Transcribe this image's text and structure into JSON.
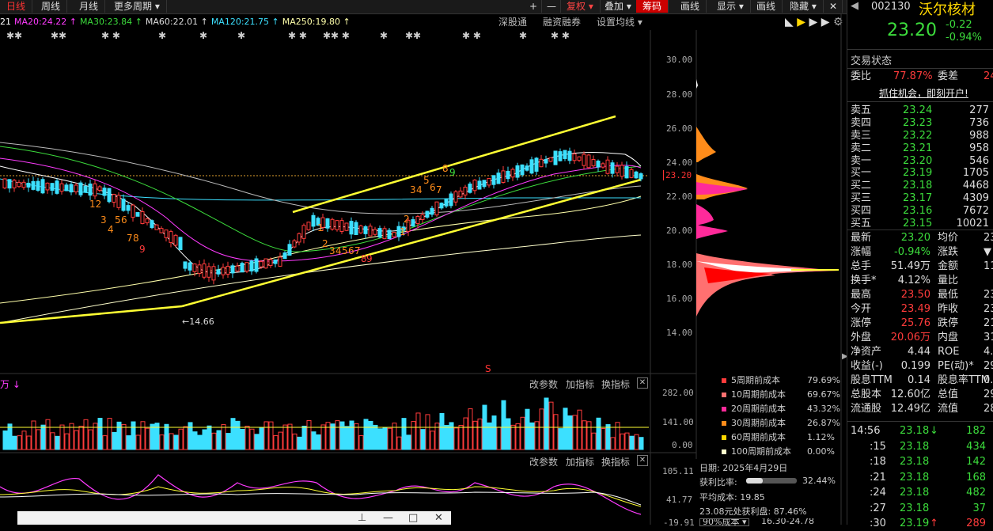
{
  "toolbar": {
    "items": [
      "日线",
      "周线",
      "月线",
      "更多周期"
    ],
    "right": [
      "+",
      "—",
      "复权",
      "叠加",
      "筹码",
      "画线",
      "显示",
      "画线",
      "隐藏"
    ]
  },
  "ma": [
    {
      "label": "21",
      "color": "#ffffff"
    },
    {
      "label": "MA20:24.22",
      "color": "#ff3bff"
    },
    {
      "label": "MA30:23.84",
      "color": "#3cdc3c"
    },
    {
      "label": "MA60:22.01",
      "color": "#dddddd"
    },
    {
      "label": "MA120:21.75",
      "color": "#3ce0ff"
    },
    {
      "label": "MA250:19.80",
      "color": "#ffffaa"
    }
  ],
  "links": {
    "a": "深股通",
    "b": "融资融券",
    "c": "设置均线"
  },
  "price_axis": [
    "30.00",
    "28.00",
    "26.00",
    "24.00",
    "23.20",
    "22.00",
    "20.00",
    "18.00",
    "16.00",
    "14.00"
  ],
  "low_mark": "←14.66",
  "vol_panel": {
    "unit": "万",
    "params": "改参数",
    "add": "加指标",
    "change": "换指标",
    "ticks": [
      "282.00",
      "141.00",
      "0.00"
    ]
  },
  "macd_panel": {
    "params": "改参数",
    "add": "加指标",
    "change": "换指标",
    "ticks": [
      "105.11",
      "41.77",
      "-19.91"
    ]
  },
  "chip_legend": [
    {
      "label": "5周期前成本",
      "value": "79.69%",
      "color": "#ff3b3b"
    },
    {
      "label": "10周期前成本",
      "value": "69.67%",
      "color": "#ff7070"
    },
    {
      "label": "20周期前成本",
      "value": "43.32%",
      "color": "#ff2a9a"
    },
    {
      "label": "30周期前成本",
      "value": "26.87%",
      "color": "#ff8c1a"
    },
    {
      "label": "60周期前成本",
      "value": "1.12%",
      "color": "#ffd700"
    },
    {
      "label": "100周期前成本",
      "value": "0.00%",
      "color": "#ffffcc"
    }
  ],
  "chip_info": {
    "date": "日期: 2025年4月29日",
    "profit_label": "获利比率:",
    "profit_value": "32.44%",
    "profit_ratio": 0.3244,
    "avg": "平均成本: 19.85",
    "at": "23.08元处获利盘: 87.46%",
    "cost_range_label": "90%成本",
    "cost_range": "16.30-24.78"
  },
  "stock": {
    "code": "002130",
    "name": "沃尔核材",
    "price": "23.20",
    "change": "-0.22",
    "pct": "-0.94%"
  },
  "trade_state": "交易状态",
  "weibi": {
    "l1": "委比",
    "v1": "77.87%",
    "l2": "委差",
    "v2": "24"
  },
  "promo": "抓住机会，即刻开户!",
  "asks": [
    {
      "label": "卖五",
      "price": "23.24",
      "vol": "277"
    },
    {
      "label": "卖四",
      "price": "23.23",
      "vol": "736"
    },
    {
      "label": "卖三",
      "price": "23.22",
      "vol": "988"
    },
    {
      "label": "卖二",
      "price": "23.21",
      "vol": "958"
    },
    {
      "label": "卖一",
      "price": "23.20",
      "vol": "546"
    }
  ],
  "bids": [
    {
      "label": "买一",
      "price": "23.19",
      "vol": "1705"
    },
    {
      "label": "买二",
      "price": "23.18",
      "vol": "4468"
    },
    {
      "label": "买三",
      "price": "23.17",
      "vol": "4309"
    },
    {
      "label": "买四",
      "price": "23.16",
      "vol": "7672"
    },
    {
      "label": "买五",
      "price": "23.15",
      "vol": "10021"
    }
  ],
  "stats": [
    {
      "l1": "最新",
      "v1": "23.20",
      "c1": "g",
      "l2": "均价",
      "v2": "23"
    },
    {
      "l1": "涨幅",
      "v1": "-0.94%",
      "c1": "g",
      "l2": "涨跌",
      "v2": "▼"
    },
    {
      "l1": "总手",
      "v1": "51.49万",
      "c1": "w",
      "l2": "金额",
      "v2": "11.9"
    },
    {
      "l1": "换手*",
      "v1": "4.12%",
      "c1": "w",
      "l2": "量比",
      "v2": ""
    },
    {
      "l1": "最高",
      "v1": "23.50",
      "c1": "r",
      "l2": "最低",
      "v2": "23"
    },
    {
      "l1": "今开",
      "v1": "23.49",
      "c1": "r",
      "l2": "昨收",
      "v2": "23"
    },
    {
      "l1": "涨停",
      "v1": "25.76",
      "c1": "r",
      "l2": "跌停",
      "v2": "21"
    },
    {
      "l1": "外盘",
      "v1": "20.06万",
      "c1": "r",
      "l2": "内盘",
      "v2": "31.4"
    },
    {
      "l1": "净资产",
      "v1": "4.44",
      "c1": "w",
      "l2": "ROE",
      "v2": "4."
    },
    {
      "l1": "收益(-)",
      "v1": "0.199",
      "c1": "w",
      "l2": "PE(动)*",
      "v2": "29"
    },
    {
      "l1": "股息TTM",
      "v1": "0.14",
      "c1": "w",
      "l2": "股息率TTM",
      "v2": "0."
    },
    {
      "l1": "总股本",
      "v1": "12.60亿",
      "c1": "w",
      "l2": "总值",
      "v2": "292"
    },
    {
      "l1": "流通股",
      "v1": "12.49亿",
      "c1": "w",
      "l2": "流值",
      "v2": "289"
    }
  ],
  "ticks": [
    {
      "t": "14:56",
      "p": "23.18",
      "arrow": "↓",
      "v": "182"
    },
    {
      "t": ":15",
      "p": "23.18",
      "arrow": "",
      "v": "434"
    },
    {
      "t": ":18",
      "p": "23.18",
      "arrow": "",
      "v": "142"
    },
    {
      "t": ":21",
      "p": "23.18",
      "arrow": "",
      "v": "168"
    },
    {
      "t": ":24",
      "p": "23.18",
      "arrow": "",
      "v": "482"
    },
    {
      "t": ":27",
      "p": "23.18",
      "arrow": "",
      "v": "37"
    },
    {
      "t": ":30",
      "p": "23.19",
      "arrow": "↑",
      "v": "289"
    }
  ],
  "channel_numbers": {
    "down": [
      "12",
      "3",
      "4",
      "5",
      "6",
      "7",
      "8",
      "9"
    ],
    "side": [
      "1",
      "2",
      "3",
      "4",
      "5",
      "6",
      "7",
      "8",
      "9"
    ],
    "up": [
      "2",
      "1",
      "3",
      "4",
      "5",
      "6",
      "7",
      "8",
      "9"
    ]
  },
  "bottombar": [
    "📌",
    "—",
    "□",
    "✕"
  ]
}
